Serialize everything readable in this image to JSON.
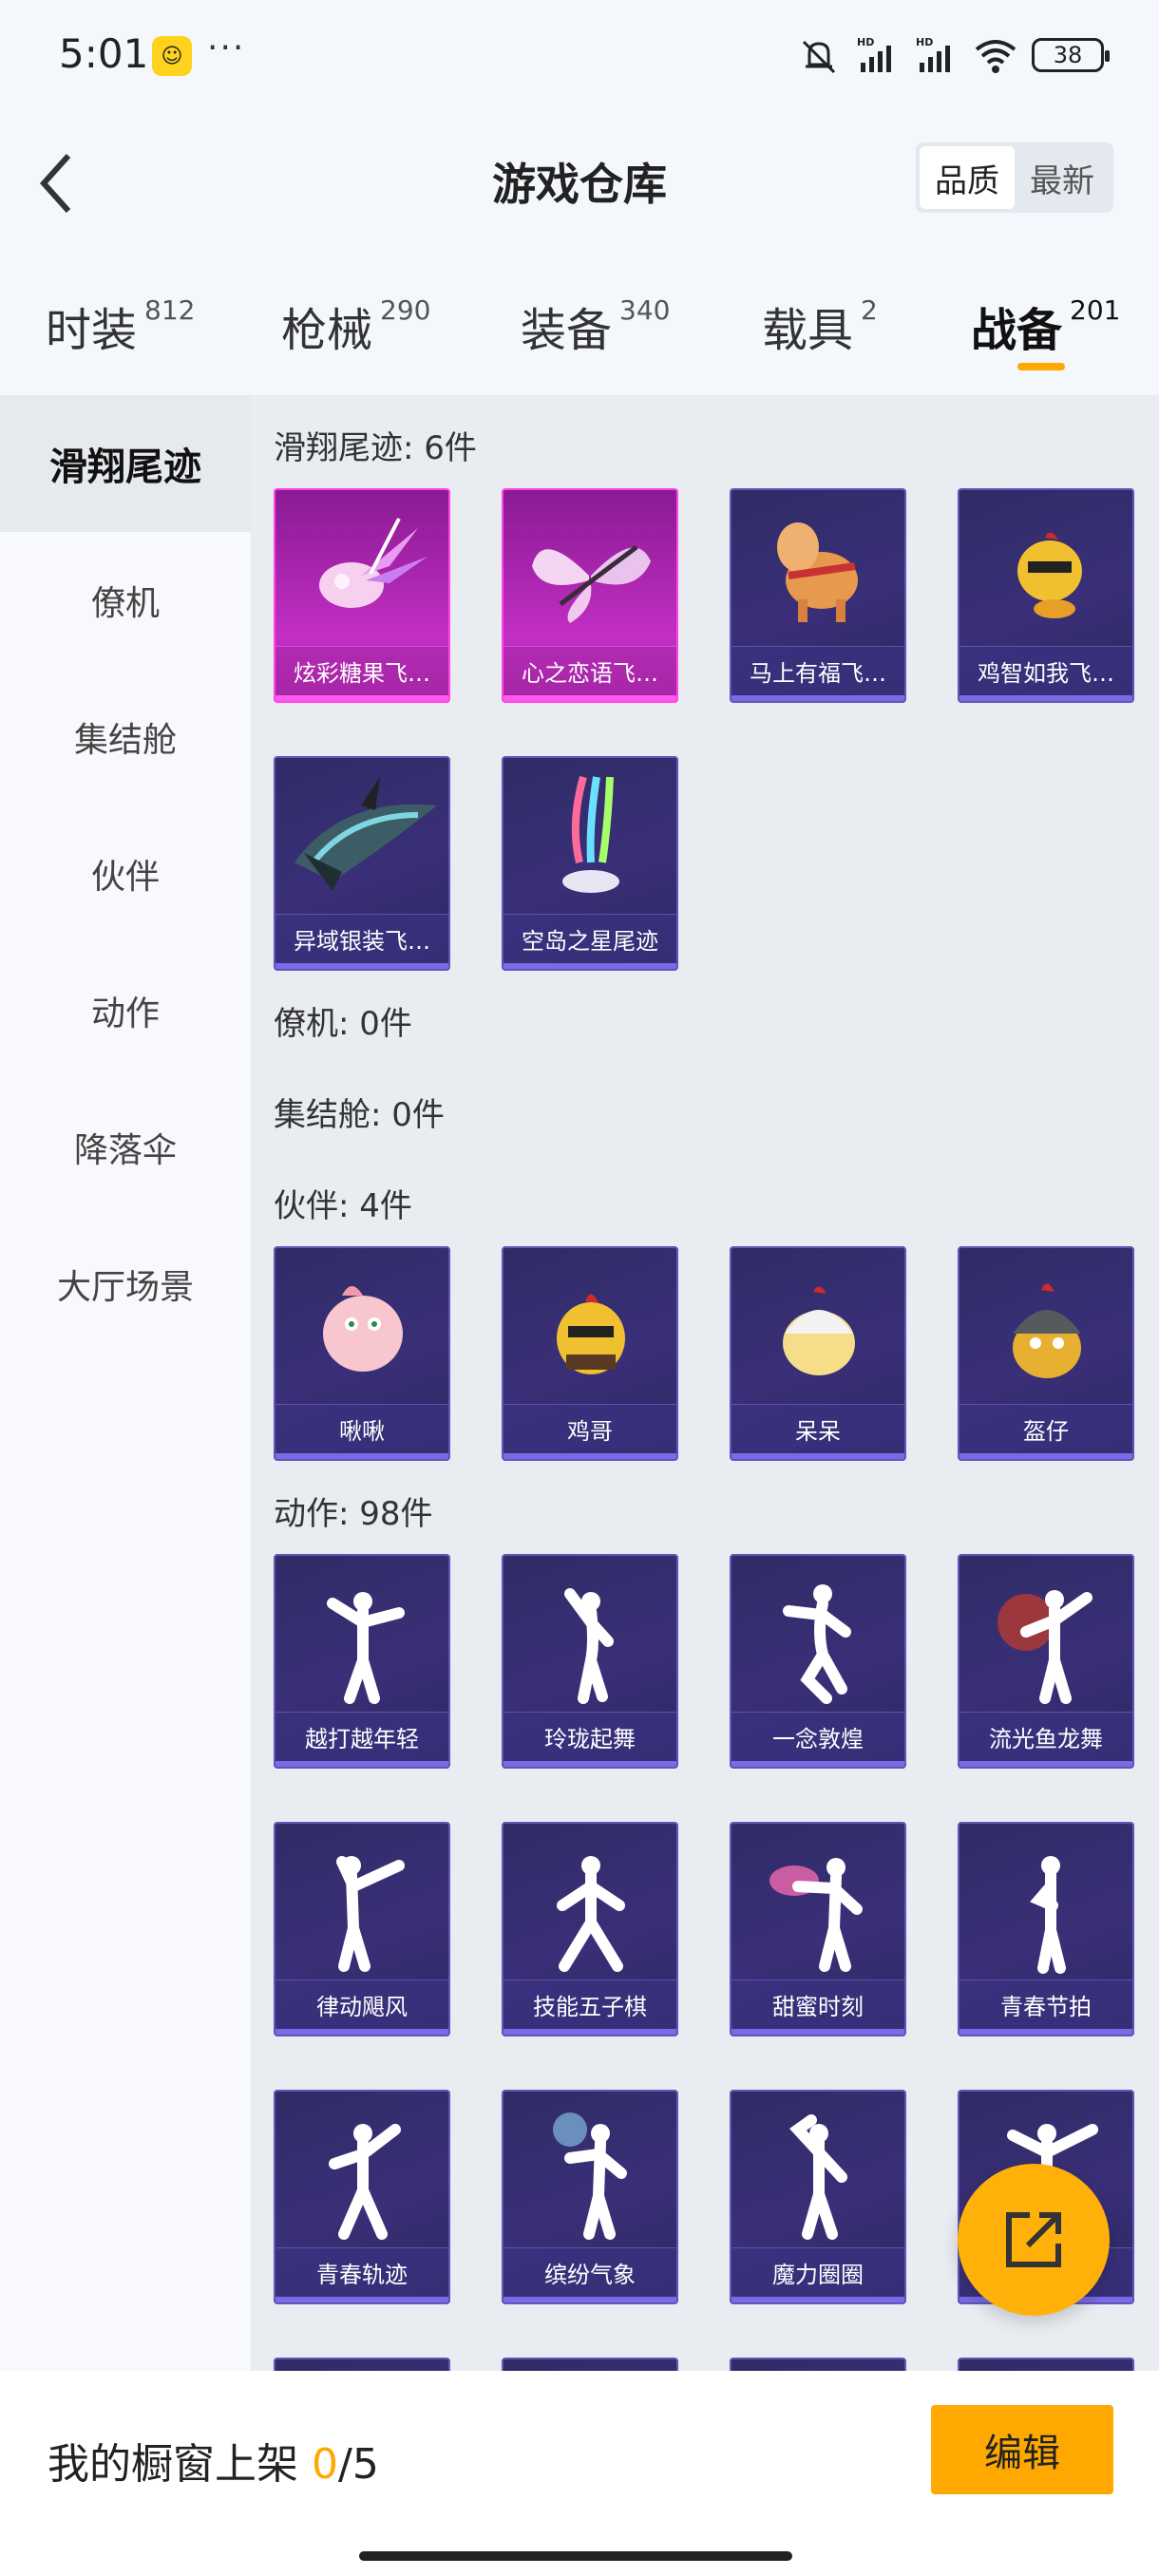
{
  "status": {
    "time": "5:01",
    "app_icon": "smiley-app-icon",
    "dots": "···",
    "battery": "38"
  },
  "header": {
    "title": "游戏仓库",
    "sort": [
      "品质",
      "最新"
    ],
    "sort_selected": "品质"
  },
  "tabs": [
    {
      "label": "时装",
      "count": "812"
    },
    {
      "label": "枪械",
      "count": "290"
    },
    {
      "label": "装备",
      "count": "340"
    },
    {
      "label": "载具",
      "count": "2"
    },
    {
      "label": "战备",
      "count": "201"
    }
  ],
  "tab_selected": "战备",
  "sidebar": {
    "items": [
      "滑翔尾迹",
      "僚机",
      "集结舱",
      "伙伴",
      "动作",
      "降落伞",
      "大厅场景"
    ],
    "selected": "滑翔尾迹"
  },
  "sections": {
    "glide": {
      "title": "滑翔尾迹: 6件",
      "items": [
        "炫彩糖果飞…",
        "心之恋语飞…",
        "马上有福飞…",
        "鸡智如我飞…",
        "异域银装飞…",
        "空岛之星尾迹"
      ]
    },
    "wingman": {
      "title": "僚机: 0件"
    },
    "assembly": {
      "title": "集结舱: 0件"
    },
    "companion": {
      "title": "伙伴: 4件",
      "items": [
        "啾啾",
        "鸡哥",
        "呆呆",
        "盔仔"
      ]
    },
    "emote": {
      "title": "动作: 98件",
      "items": [
        "越打越年轻",
        "玲珑起舞",
        "一念敦煌",
        "流光鱼龙舞",
        "律动飓风",
        "技能五子棋",
        "甜蜜时刻",
        "青春节拍",
        "青春轨迹",
        "缤纷气象",
        "魔力圈圈",
        ""
      ]
    }
  },
  "bottom": {
    "showcase_label": "我的橱窗上架 ",
    "showcase_current": "0",
    "showcase_total": "/5",
    "edit_label": "编辑"
  }
}
